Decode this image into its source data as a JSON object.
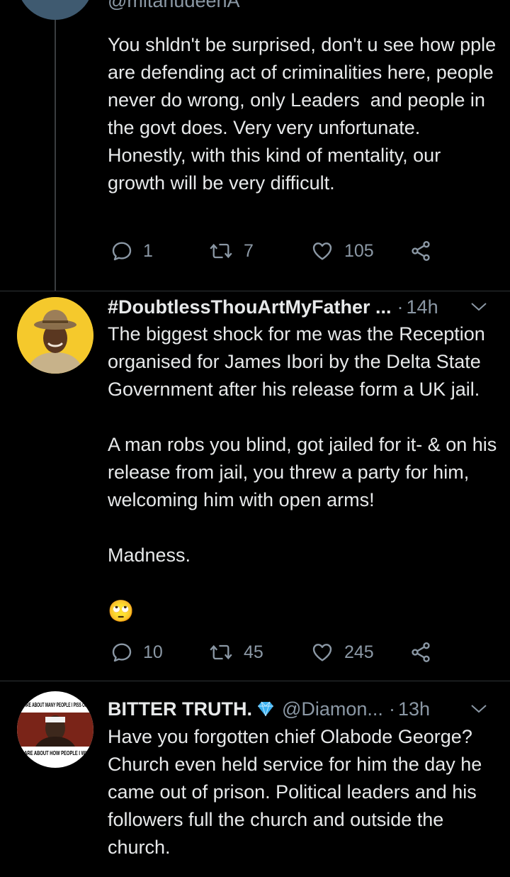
{
  "tweets": [
    {
      "handle": "@mltanudeenA",
      "body": "You shldn't be surprised, don't u see how pple are defending act of criminalities here, people never do wrong, only Leaders  and people in the govt does. Very very unfortunate. Honestly, with this kind of mentality, our growth will be very difficult.",
      "replies": "1",
      "retweets": "7",
      "likes": "105"
    },
    {
      "name": "#DoubtlessThouArtMyFather ...",
      "separator": "·",
      "time": "14h",
      "body": "The biggest shock for me was the Reception organised for James Ibori by the Delta State Government after his release form a UK jail.\n\nA man robs you blind, got jailed for it- & on his release from jail, you threw a party for him, welcoming him with open arms!\n\nMadness.",
      "emoji": "🙄",
      "replies": "10",
      "retweets": "45",
      "likes": "245"
    },
    {
      "name": "BITTER TRUTH.",
      "handle": "@Diamon...",
      "separator": "·",
      "time": "13h",
      "avatar_text_top": "CARE ABOUT MANY PEOPLE I PISS OFF",
      "avatar_text_bottom": "CARE ABOUT HOW PEOPLE I WIN",
      "body": "Have you forgotten chief Olabode George? Church even held service for him the day he came out of prison. Political leaders and his followers full the church and outside the church."
    }
  ],
  "icons": {
    "reply": "reply-icon",
    "retweet": "retweet-icon",
    "like": "heart-icon",
    "share": "share-icon",
    "more": "chevron-down-icon",
    "verified": "diamond-icon"
  },
  "colors": {
    "background": "#000000",
    "text": "#e7e9ea",
    "secondary": "#8b98a5",
    "divider": "#2f3336",
    "diamond": "#3ab0f0"
  }
}
